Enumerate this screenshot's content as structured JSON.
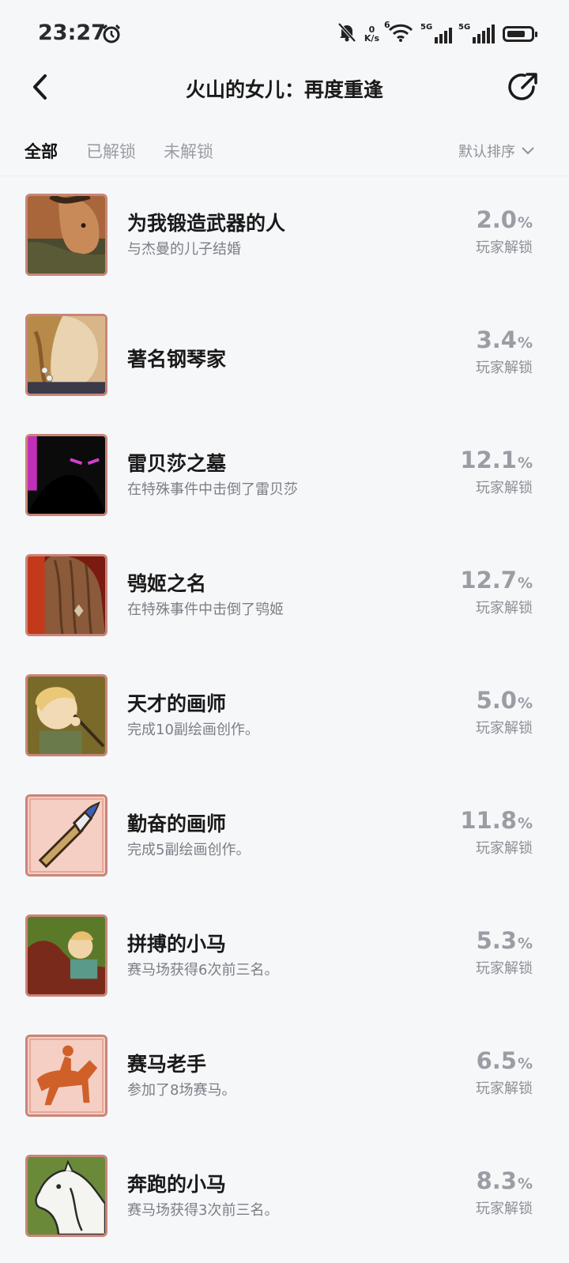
{
  "status_bar": {
    "time": "23:27",
    "net_speed_value": "0",
    "net_speed_unit": "K/s",
    "wifi_label": "6",
    "sim1_label": "5G",
    "sim2_label": "5G",
    "battery_level": 0.8,
    "icons": [
      "alarm-icon",
      "mute-icon",
      "wifi-icon",
      "signal-icon",
      "battery-icon"
    ]
  },
  "nav": {
    "title": "火山的女儿：再度重逢",
    "icons": [
      "back-arrow-icon",
      "share-icon"
    ]
  },
  "filters": {
    "tabs": [
      {
        "label": "全部",
        "active": true
      },
      {
        "label": "已解锁",
        "active": false
      },
      {
        "label": "未解锁",
        "active": false
      }
    ],
    "sort_label": "默认排序"
  },
  "achievements": [
    {
      "name": "为我锻造武器的人",
      "desc": "与杰曼的儿子结婚",
      "rate": "2.0",
      "unlock_label": "玩家解锁",
      "icon": "portrait-icon"
    },
    {
      "name": "著名钢琴家",
      "desc": "",
      "rate": "3.4",
      "unlock_label": "玩家解锁",
      "icon": "portrait-icon"
    },
    {
      "name": "雷贝莎之墓",
      "desc": "在特殊事件中击倒了雷贝莎",
      "rate": "12.1",
      "unlock_label": "玩家解锁",
      "icon": "shadow-figure-icon"
    },
    {
      "name": "鸮姬之名",
      "desc": "在特殊事件中击倒了鸮姬",
      "rate": "12.7",
      "unlock_label": "玩家解锁",
      "icon": "portrait-icon"
    },
    {
      "name": "天才的画师",
      "desc": "完成10副绘画创作。",
      "rate": "5.0",
      "unlock_label": "玩家解锁",
      "icon": "portrait-icon"
    },
    {
      "name": "勤奋的画师",
      "desc": "完成5副绘画创作。",
      "rate": "11.8",
      "unlock_label": "玩家解锁",
      "icon": "paintbrush-icon"
    },
    {
      "name": "拼搏的小马",
      "desc": "赛马场获得6次前三名。",
      "rate": "5.3",
      "unlock_label": "玩家解锁",
      "icon": "horse-rider-icon"
    },
    {
      "name": "赛马老手",
      "desc": "参加了8场赛马。",
      "rate": "6.5",
      "unlock_label": "玩家解锁",
      "icon": "horse-rider-icon"
    },
    {
      "name": "奔跑的小马",
      "desc": "赛马场获得3次前三名。",
      "rate": "8.3",
      "unlock_label": "玩家解锁",
      "icon": "horse-icon"
    }
  ],
  "percent_sign": "%"
}
